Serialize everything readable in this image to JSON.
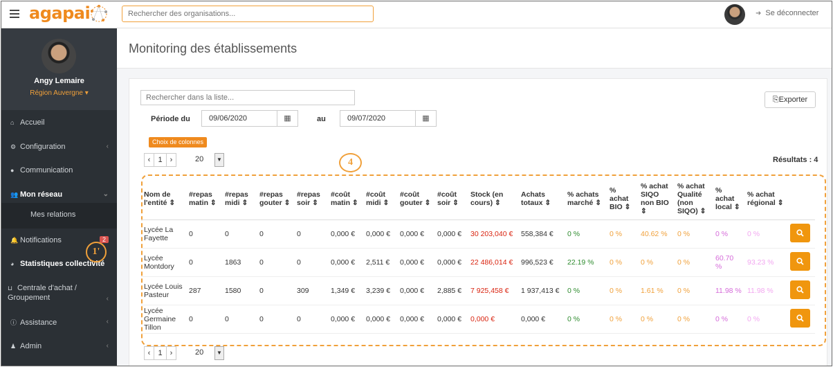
{
  "topbar": {
    "logo": "agapai",
    "search_placeholder": "Rechercher des organisations...",
    "logout_label": "Se déconnecter",
    "icons": [
      "menu-icon",
      "logout-icon"
    ]
  },
  "sidebar": {
    "user_name": "Angy Lemaire",
    "user_region": "Région Auvergne ▾",
    "items": [
      {
        "label": "Accueil",
        "icon": "home-icon"
      },
      {
        "label": "Configuration",
        "icon": "gears-icon"
      },
      {
        "label": "Communication",
        "icon": "comments-icon"
      },
      {
        "label": "Mon réseau",
        "icon": "users-icon"
      },
      {
        "label": "Mes relations"
      },
      {
        "label": "Notifications",
        "icon": "bell-icon",
        "badge": "2"
      },
      {
        "label": "Statistiques collectivité",
        "icon": "pie-chart-icon"
      },
      {
        "label": "Centrale d'achat / Groupement",
        "icon": "basket-icon"
      },
      {
        "label": "Assistance",
        "icon": "info-icon"
      },
      {
        "label": "Admin",
        "icon": "user-admin-icon"
      }
    ],
    "annotation": "1'"
  },
  "main": {
    "title": "Monitoring des établissements",
    "list_search_placeholder": "Rechercher dans la liste...",
    "export_label": "Exporter",
    "period_from_label": "Période du",
    "date_from": "09/06/2020",
    "period_to_label": "au",
    "date_to": "09/07/2020",
    "columns_button": "Choix de colonnes",
    "pager": {
      "prev": "‹",
      "page": "1",
      "next": "›",
      "page_size": "20"
    },
    "results": "Résultats : 4",
    "annotation": "4"
  },
  "table": {
    "headers": [
      "Nom de l'entité ⇕",
      "#repas matin ⇕",
      "#repas midi ⇕",
      "#repas gouter ⇕",
      "#repas soir ⇕",
      "#coût matin ⇕",
      "#coût midi ⇕",
      "#coût gouter ⇕",
      "#coût soir ⇕",
      "Stock (en cours) ⇕",
      "Achats totaux ⇕",
      "% achats marché ⇕",
      "% achat BIO ⇕",
      "% achat SIQO non BIO ⇕",
      "% achat Qualité (non SIQO) ⇕",
      "% achat local ⇕",
      "% achat régional ⇕"
    ],
    "rows": [
      [
        "Lycée La Fayette",
        "0",
        "0",
        "0",
        "0",
        "0,000 €",
        "0,000 €",
        "0,000 €",
        "0,000 €",
        "30 203,040 €",
        "558,384 €",
        "0 %",
        "0 %",
        "40.62 %",
        "0 %",
        "0 %",
        "0 %"
      ],
      [
        "Lycée Montdory",
        "0",
        "1863",
        "0",
        "0",
        "0,000 €",
        "2,511 €",
        "0,000 €",
        "0,000 €",
        "22 486,014 €",
        "996,523 €",
        "22.19 %",
        "0 %",
        "0 %",
        "0 %",
        "60.70 %",
        "93.23 %"
      ],
      [
        "Lycée Louis Pasteur",
        "287",
        "1580",
        "0",
        "309",
        "1,349 €",
        "3,239 €",
        "0,000 €",
        "2,885 €",
        "7 925,458 €",
        "1 937,413 €",
        "0 %",
        "0 %",
        "1.61 %",
        "0 %",
        "11.98 %",
        "11.98 %"
      ],
      [
        "Lycée Germaine Tillon",
        "0",
        "0",
        "0",
        "0",
        "0,000 €",
        "0,000 €",
        "0,000 €",
        "0,000 €",
        "0,000 €",
        "0,000 €",
        "0 %",
        "0 %",
        "0 %",
        "0 %",
        "0 %",
        "0 %"
      ]
    ],
    "row_action_icon": "search-icon",
    "colors": {
      "stock": "#d9230f",
      "market": "#2e8b2e",
      "bio_siqo": "#f0a03a",
      "local": "#d56bd9",
      "regional": "#f2a7f0"
    }
  }
}
